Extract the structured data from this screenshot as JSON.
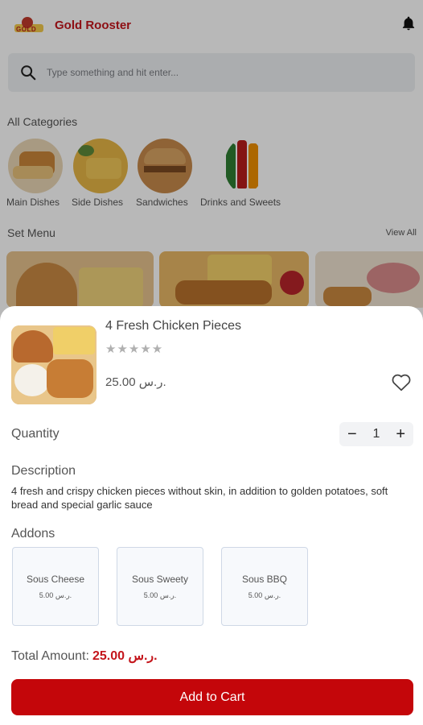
{
  "header": {
    "brand": "Gold Rooster",
    "logo_text": "GOLD"
  },
  "search": {
    "placeholder": "Type something and hit enter..."
  },
  "categories": {
    "title": "All Categories",
    "items": [
      {
        "label": "Main Dishes"
      },
      {
        "label": "Side Dishes"
      },
      {
        "label": "Sandwiches"
      },
      {
        "label": "Drinks and Sweets"
      }
    ]
  },
  "set_menu": {
    "title": "Set Menu",
    "view_all": "View All"
  },
  "product": {
    "name": "4 Fresh Chicken Pieces",
    "rating": 0,
    "stars": "★★★★★",
    "price": "25.00 ر.س.",
    "quantity_label": "Quantity",
    "quantity": "1",
    "minus": "−",
    "plus": "+",
    "description_label": "Description",
    "description": "4 fresh and crispy chicken pieces without skin, in addition to golden potatoes, soft bread and special garlic sauce",
    "addons_label": "Addons",
    "addons": [
      {
        "name": "Sous Cheese",
        "price": "5.00 ر.س."
      },
      {
        "name": "Sous Sweety",
        "price": "5.00 ر.س."
      },
      {
        "name": "Sous BBQ",
        "price": "5.00 ر.س."
      }
    ],
    "total_label": "Total Amount:",
    "total": "25.00 ر.س.",
    "add_to_cart": "Add to Cart"
  },
  "colors": {
    "brand": "#c4161c",
    "button": "#c4060a"
  },
  "icons": [
    "search-icon",
    "bell-icon",
    "heart-icon",
    "star-icon"
  ]
}
